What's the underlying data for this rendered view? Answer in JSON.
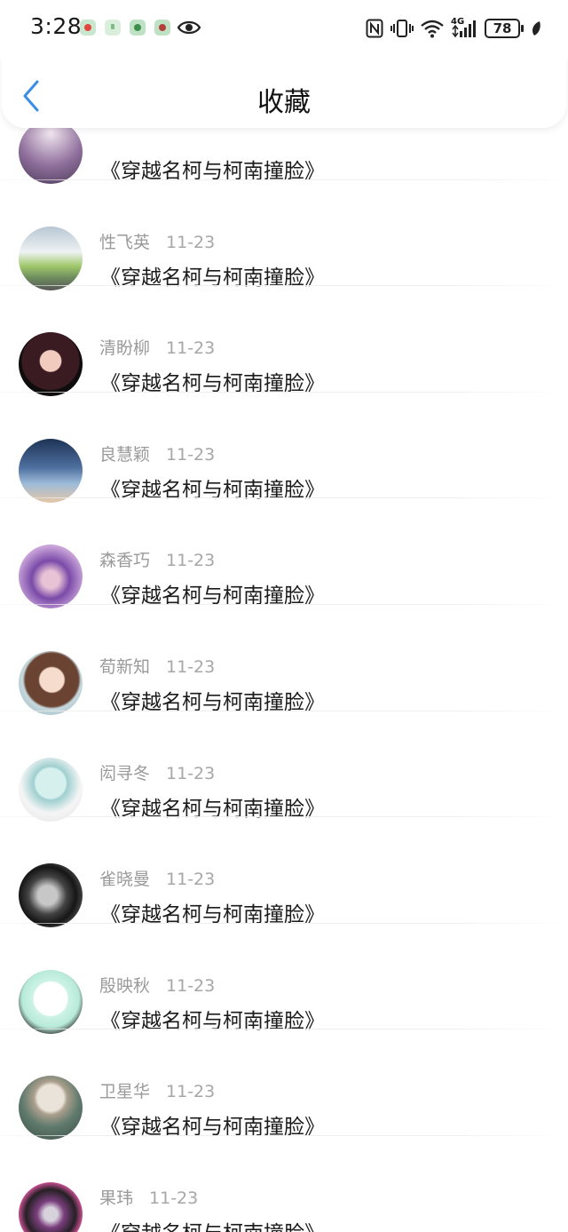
{
  "status_bar": {
    "time": "3:28",
    "battery": "78",
    "network": "4G",
    "icons": [
      "screen-record-icon",
      "pause-notification-icon",
      "music-app-icon",
      "media-app-icon",
      "eye-icon",
      "nfc-icon",
      "vibrate-icon",
      "wifi-icon",
      "cellular-signal-icon",
      "battery-icon",
      "leaf-icon"
    ]
  },
  "nav": {
    "title": "收藏",
    "back_icon": "chevron-left-icon",
    "accent_color": "#3a8ee6"
  },
  "favorites": [
    {
      "name": "",
      "date": "",
      "book": "《穿越名柯与柯南撞脸》"
    },
    {
      "name": "性飞英",
      "date": "11-23",
      "book": "《穿越名柯与柯南撞脸》"
    },
    {
      "name": "清盼柳",
      "date": "11-23",
      "book": "《穿越名柯与柯南撞脸》"
    },
    {
      "name": "良慧颖",
      "date": "11-23",
      "book": "《穿越名柯与柯南撞脸》"
    },
    {
      "name": "森香巧",
      "date": "11-23",
      "book": "《穿越名柯与柯南撞脸》"
    },
    {
      "name": "荀新知",
      "date": "11-23",
      "book": "《穿越名柯与柯南撞脸》"
    },
    {
      "name": "闳寻冬",
      "date": "11-23",
      "book": "《穿越名柯与柯南撞脸》"
    },
    {
      "name": "雀晓曼",
      "date": "11-23",
      "book": "《穿越名柯与柯南撞脸》"
    },
    {
      "name": "殷映秋",
      "date": "11-23",
      "book": "《穿越名柯与柯南撞脸》"
    },
    {
      "name": "卫星华",
      "date": "11-23",
      "book": "《穿越名柯与柯南撞脸》"
    },
    {
      "name": "果玮",
      "date": "11-23",
      "book": "《穿越名柯与柯南撞脸》"
    }
  ]
}
